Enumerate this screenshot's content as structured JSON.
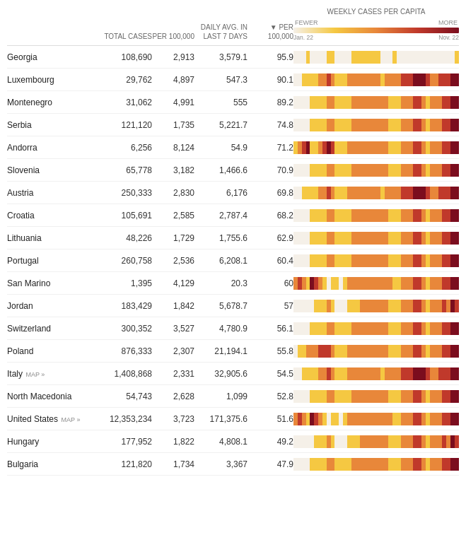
{
  "header": {
    "columns": {
      "country": "",
      "total_cases": "TOTAL CASES",
      "per_100k": "PER 100,000",
      "daily_avg": "DAILY AVG. IN LAST 7 DAYS",
      "per_100k_arrow": "▼ PER 100,000",
      "weekly": "WEEKLY CASES PER CAPITA"
    },
    "chart_labels": {
      "fewer": "FEWER",
      "more": "MORE",
      "date_start": "Jan. 22",
      "date_end": "Nov. 22"
    }
  },
  "rows": [
    {
      "country": "Georgia",
      "map": false,
      "total": "108,690",
      "per100k": "2,913",
      "daily": "3,579.1",
      "per100k2": "95.9",
      "heatmap": "light"
    },
    {
      "country": "Luxembourg",
      "map": false,
      "total": "29,762",
      "per100k": "4,897",
      "daily": "547.3",
      "per100k2": "90.1",
      "heatmap": "medium-high"
    },
    {
      "country": "Montenegro",
      "map": false,
      "total": "31,062",
      "per100k": "4,991",
      "daily": "555",
      "per100k2": "89.2",
      "heatmap": "medium"
    },
    {
      "country": "Serbia",
      "map": false,
      "total": "121,120",
      "per100k": "1,735",
      "daily": "5,221.7",
      "per100k2": "74.8",
      "heatmap": "medium"
    },
    {
      "country": "Andorra",
      "map": false,
      "total": "6,256",
      "per100k": "8,124",
      "daily": "54.9",
      "per100k2": "71.2",
      "heatmap": "high"
    },
    {
      "country": "Slovenia",
      "map": false,
      "total": "65,778",
      "per100k": "3,182",
      "daily": "1,466.6",
      "per100k2": "70.9",
      "heatmap": "medium"
    },
    {
      "country": "Austria",
      "map": false,
      "total": "250,333",
      "per100k": "2,830",
      "daily": "6,176",
      "per100k2": "69.8",
      "heatmap": "medium-high"
    },
    {
      "country": "Croatia",
      "map": false,
      "total": "105,691",
      "per100k": "2,585",
      "daily": "2,787.4",
      "per100k2": "68.2",
      "heatmap": "medium"
    },
    {
      "country": "Lithuania",
      "map": false,
      "total": "48,226",
      "per100k": "1,729",
      "daily": "1,755.6",
      "per100k2": "62.9",
      "heatmap": "medium"
    },
    {
      "country": "Portugal",
      "map": false,
      "total": "260,758",
      "per100k": "2,536",
      "daily": "6,208.1",
      "per100k2": "60.4",
      "heatmap": "medium"
    },
    {
      "country": "San Marino",
      "map": false,
      "total": "1,395",
      "per100k": "4,129",
      "daily": "20.3",
      "per100k2": "60",
      "heatmap": "high-varied"
    },
    {
      "country": "Jordan",
      "map": false,
      "total": "183,429",
      "per100k": "1,842",
      "daily": "5,678.7",
      "per100k2": "57",
      "heatmap": "medium-light"
    },
    {
      "country": "Switzerland",
      "map": false,
      "total": "300,352",
      "per100k": "3,527",
      "daily": "4,780.9",
      "per100k2": "56.1",
      "heatmap": "medium"
    },
    {
      "country": "Poland",
      "map": false,
      "total": "876,333",
      "per100k": "2,307",
      "daily": "21,194.1",
      "per100k2": "55.8",
      "heatmap": "medium-dark"
    },
    {
      "country": "Italy",
      "map": true,
      "total": "1,408,868",
      "per100k": "2,331",
      "daily": "32,905.6",
      "per100k2": "54.5",
      "heatmap": "medium-high"
    },
    {
      "country": "North Macedonia",
      "map": false,
      "total": "54,743",
      "per100k": "2,628",
      "daily": "1,099",
      "per100k2": "52.8",
      "heatmap": "medium"
    },
    {
      "country": "United States",
      "map": true,
      "total": "12,353,234",
      "per100k": "3,723",
      "daily": "171,375.6",
      "per100k2": "51.6",
      "heatmap": "high-varied"
    },
    {
      "country": "Hungary",
      "map": false,
      "total": "177,952",
      "per100k": "1,822",
      "daily": "4,808.1",
      "per100k2": "49.2",
      "heatmap": "medium-light"
    },
    {
      "country": "Bulgaria",
      "map": false,
      "total": "121,820",
      "per100k": "1,734",
      "daily": "3,367",
      "per100k2": "47.9",
      "heatmap": "medium"
    }
  ]
}
